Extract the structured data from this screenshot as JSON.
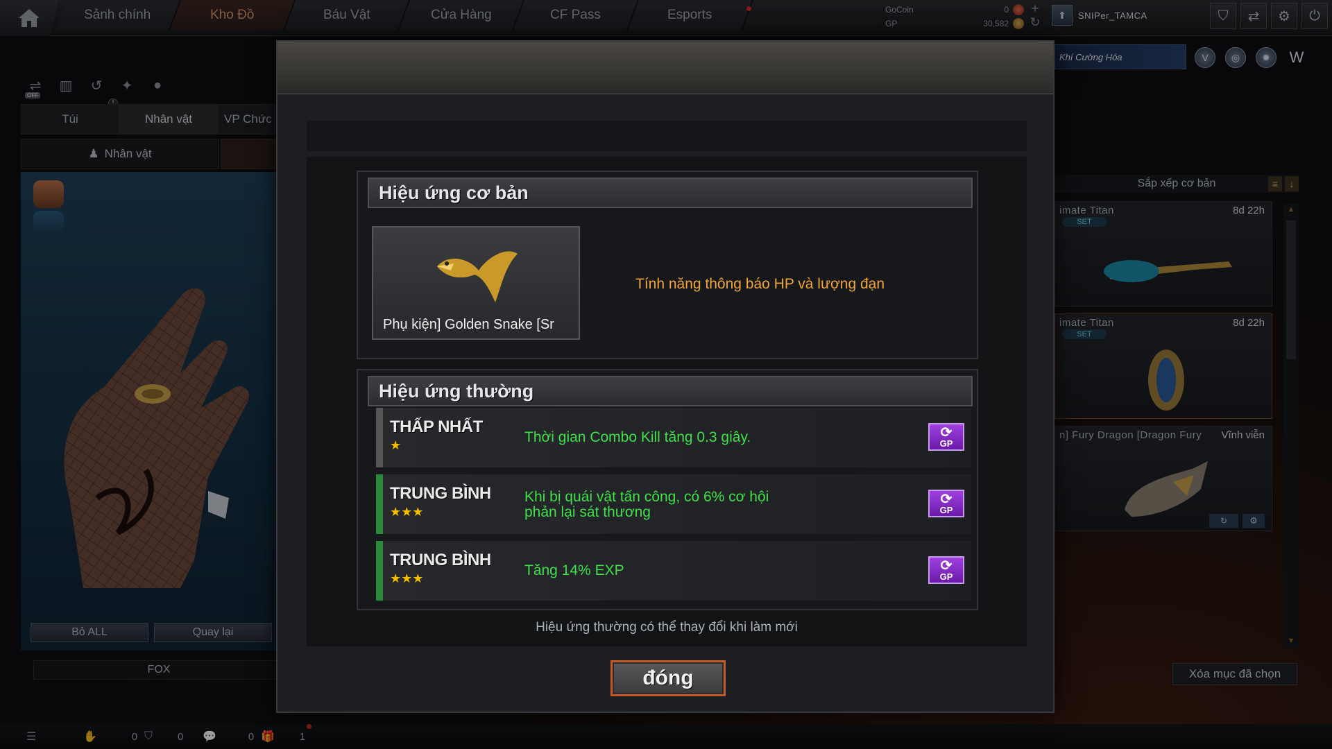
{
  "topbar": {
    "tabs": [
      "Sảnh chính",
      "Kho Đồ",
      "Báu Vật",
      "Cửa Hàng",
      "CF Pass",
      "Esports"
    ],
    "active_tab": "Kho Đồ",
    "currency": {
      "gocoin_label": "GoCoin",
      "gocoin_value": "0",
      "gp_label": "GP",
      "gp_value": "30,582"
    },
    "player_name": "SNIPer_TAMCA",
    "icons": [
      "shield-icon",
      "exchange-icon",
      "gear-icon",
      "power-icon"
    ]
  },
  "left": {
    "tabs": [
      "Túi",
      "Nhân vật",
      "VP Chức"
    ],
    "active_tab": "Nhân vật",
    "sub_tab": "Nhân vật",
    "buttons": {
      "remove_all": "Bỏ ALL",
      "back": "Quay lại"
    },
    "character_name": "FOX"
  },
  "right": {
    "weapon_banner": "Khí Cường Hóa",
    "sort_label": "Sắp xếp cơ bản",
    "items": [
      {
        "name": "imate Titan",
        "time": "8d 22h",
        "tag": "SET"
      },
      {
        "name": "imate Titan",
        "time": "8d 22h",
        "tag": "SET"
      },
      {
        "name": "n] Fury Dragon [Dragon Fury",
        "time": "Vĩnh viễn",
        "tag": ""
      }
    ],
    "clear_selection": "Xóa mục đã chọn"
  },
  "bottombar": {
    "counts": [
      "0",
      "0",
      "0",
      "1"
    ]
  },
  "modal": {
    "basic_section_title": "Hiệu ứng cơ bản",
    "item_label": "Phụ kiện] Golden Snake [Sr",
    "basic_effect": "Tính năng thông báo HP và lượng đạn",
    "normal_section_title": "Hiệu ứng thường",
    "effects": [
      {
        "rank": "THẤP NHẤT",
        "stars": "★",
        "text": "Thời gian Combo Kill tăng 0.3 giây.",
        "gp_label": "GP"
      },
      {
        "rank": "TRUNG BÌNH",
        "stars": "★★★",
        "text": "Khi bị quái vật tấn công, có 6% cơ hội phản lại sát thương",
        "gp_label": "GP"
      },
      {
        "rank": "TRUNG BÌNH",
        "stars": "★★★",
        "text": "Tăng 14% EXP",
        "gp_label": "GP"
      }
    ],
    "footnote": "Hiệu ứng thường có thể thay đổi khi làm mới",
    "close_label": "đóng"
  },
  "colors": {
    "accent_orange": "#f0a63a",
    "effect_green": "#3fe04a",
    "close_border": "#c25a2a",
    "gp_purple": "#8a2ad0"
  }
}
